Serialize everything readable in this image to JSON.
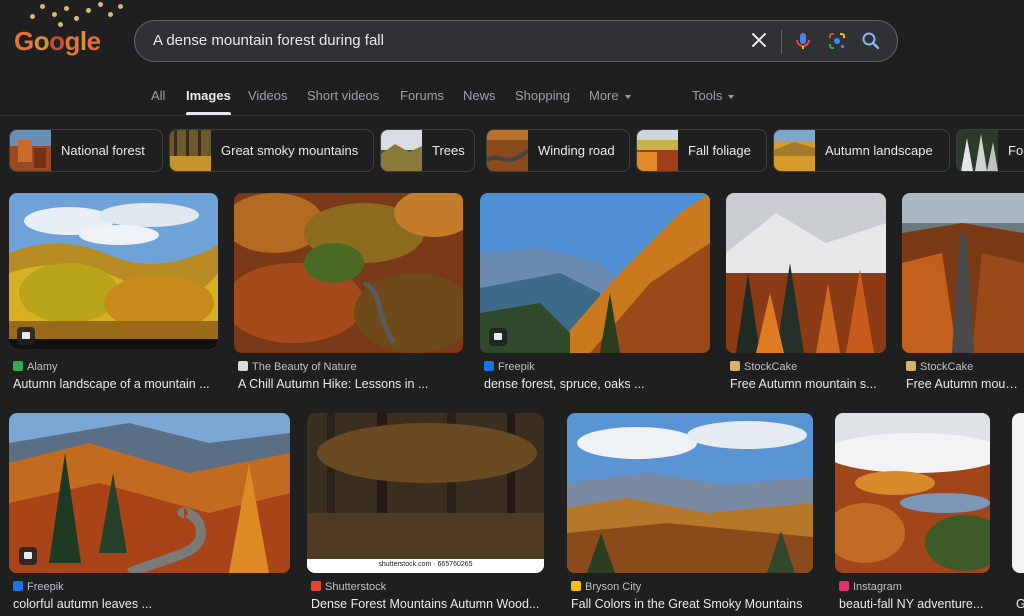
{
  "header": {
    "logo_text": "Google",
    "search": {
      "query": "A dense mountain forest during fall"
    },
    "tabs": [
      {
        "label": "All"
      },
      {
        "label": "Images"
      },
      {
        "label": "Videos"
      },
      {
        "label": "Short videos"
      },
      {
        "label": "Forums"
      },
      {
        "label": "News"
      },
      {
        "label": "Shopping"
      },
      {
        "label": "More"
      }
    ],
    "tools_label": "Tools",
    "active_tab": "Images"
  },
  "chips": [
    {
      "label": "National forest"
    },
    {
      "label": "Great smoky mountains"
    },
    {
      "label": "Trees"
    },
    {
      "label": "Winding road"
    },
    {
      "label": "Fall foliage"
    },
    {
      "label": "Autumn landscape"
    },
    {
      "label": "Fo"
    }
  ],
  "results": [
    {
      "source": "Alamy",
      "title": "Autumn landscape of a mountain ...",
      "fav_color": "#34a853"
    },
    {
      "source": "The Beauty of Nature",
      "title": "A Chill Autumn Hike: Lessons in ...",
      "fav_color": "#dadce0"
    },
    {
      "source": "Freepik",
      "title": "dense forest, spruce, oaks ...",
      "fav_color": "#1a73e8"
    },
    {
      "source": "StockCake",
      "title": "Free Autumn mountain s...",
      "fav_color": "#d6b26a"
    },
    {
      "source": "StockCake",
      "title": "Free Autumn mount...",
      "fav_color": "#d6b26a"
    },
    {
      "source": "Freepik",
      "title": "colorful autumn leaves ...",
      "fav_color": "#1a73e8"
    },
    {
      "source": "Shutterstock",
      "title": "Dense Forest Mountains Autumn Wood...",
      "fav_color": "#ea4335",
      "watermark": "shutterstock.com · 665760265"
    },
    {
      "source": "Bryson City",
      "title": "Fall Colors in the Great Smoky Mountains",
      "fav_color": "#fbbc04"
    },
    {
      "source": "Instagram",
      "title": "beauti-fall NY adventure...",
      "fav_color": "#e1306c"
    },
    {
      "source": "Gr",
      "title": "Gr",
      "fav_color": "#9aa0a6"
    }
  ],
  "icons": {
    "clear": "close-icon",
    "mic": "microphone-icon",
    "lens": "google-lens-icon",
    "search": "search-icon",
    "video_badge": "video-badge-icon"
  },
  "colors": {
    "background": "#1f1f1f",
    "search_bg": "#303134",
    "text_primary": "#e8eaed",
    "text_secondary": "#9aa0a6"
  }
}
